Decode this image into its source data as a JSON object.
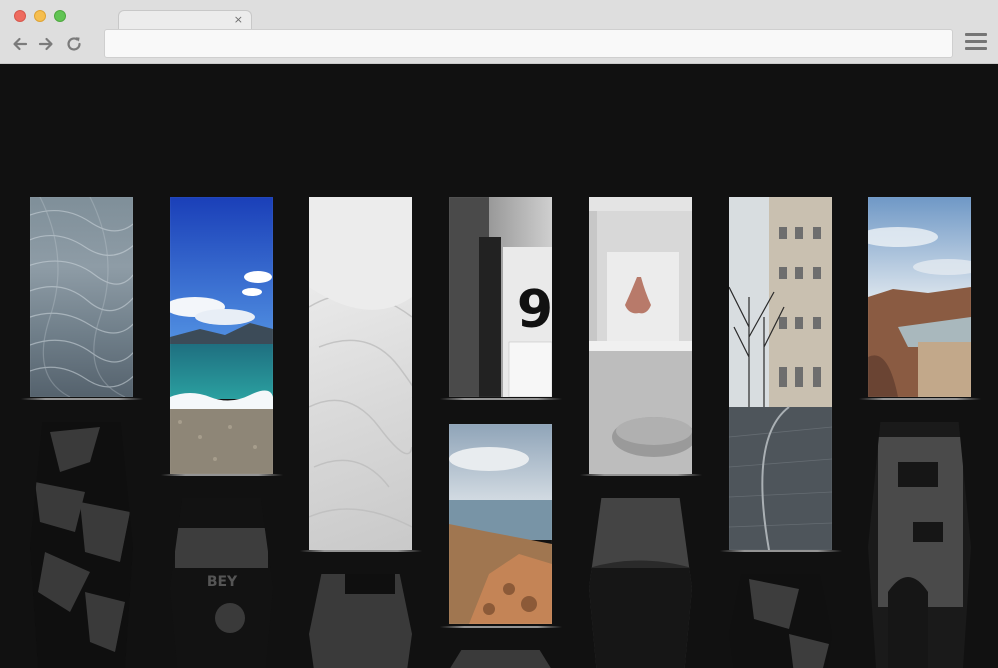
{
  "browser": {
    "tab_title": "",
    "tab_close_glyph": "×",
    "url": "",
    "icons": {
      "back": "arrow-left-icon",
      "forward": "arrow-right-icon",
      "reload": "reload-icon",
      "menu": "hamburger-menu-icon"
    }
  },
  "gallery": {
    "background": "#111111",
    "photos": [
      {
        "subject": "water-ripples-photo"
      },
      {
        "subject": "lake-beach-photo"
      },
      {
        "subject": "bedsheet-photo"
      },
      {
        "subject": "number-card-photo",
        "number_text": "9"
      },
      {
        "subject": "nose-sculpture-photo"
      },
      {
        "subject": "rainy-street-photo"
      },
      {
        "subject": "dam-canyon-photo"
      },
      {
        "subject": "coastal-cliff-photo"
      }
    ]
  }
}
